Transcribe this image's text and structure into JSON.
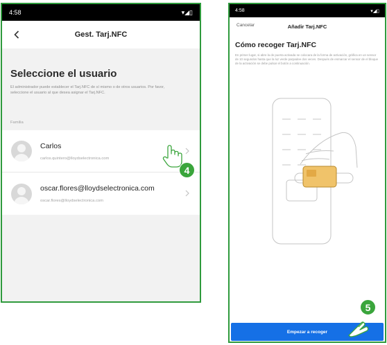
{
  "left_screen": {
    "status": {
      "time": "4:58",
      "icons": "▾◢▯"
    },
    "nav": {
      "title": "Gest. Tarj.NFC"
    },
    "heading": "Seleccione el usuario",
    "description": "El administrador puede establecer el Tarj.NFC de sí mismo o de otros usuarios. Por favor, seleccione el usuario al que desea asignar el Tarj.NFC.",
    "section_label": "Familia",
    "users": [
      {
        "name": "Carlos",
        "email": "carlos.quintero@lloydselectronica.com"
      },
      {
        "name": "oscar.flores@lloydselectronica.com",
        "email": "oscar.flores@lloydselectronica.com"
      }
    ]
  },
  "right_screen": {
    "status": {
      "time": "4:58",
      "icons": "▾◢▯"
    },
    "nav": {
      "cancel_label": "Cancelar",
      "title": "Añadir Tarj.NFC"
    },
    "heading": "Cómo recoger Tarj.NFC",
    "description": "En primer lugar, si abre la de puerta activada se colocara de la forma de activación, gráfica en un sensor de 10 segundos hasta que la luz verde parpadee dos veces. Después de enmarcar el sensor de el bloque de la activación se debe pulsar el botón a continuación.",
    "start_button": "Empezar a recoger"
  },
  "annotations": {
    "step_left": "4",
    "step_right": "5"
  },
  "colors": {
    "frame": "#2e9a3c",
    "badge": "#3aa53c",
    "primary_button": "#1570e6"
  }
}
